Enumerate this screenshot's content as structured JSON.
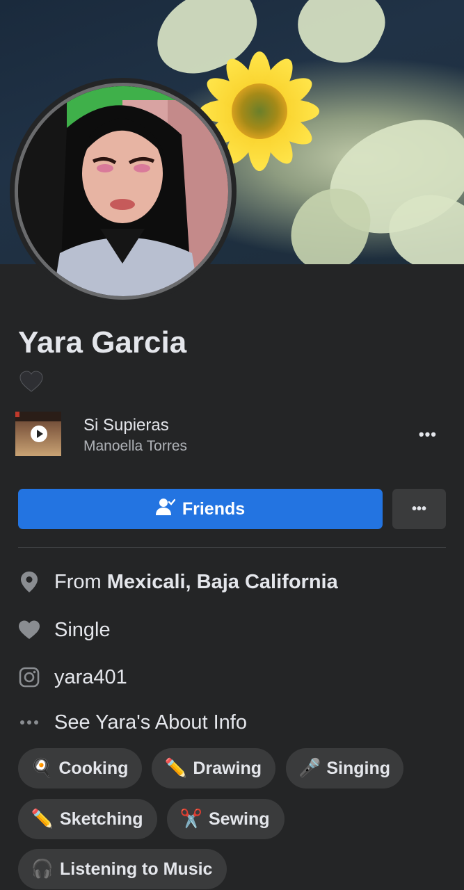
{
  "profile": {
    "name": "Yara Garcia",
    "bio_emoji": "🖤"
  },
  "profile_song": {
    "title": "Si Supieras",
    "artist": "Manoella Torres",
    "more_label": "•••"
  },
  "actions": {
    "friends_label": "Friends",
    "more_label": "•••"
  },
  "intro": {
    "from_prefix": "From ",
    "from_place": "Mexicali, Baja California",
    "relationship": "Single",
    "instagram": "yara401",
    "about_link": "See Yara's About Info"
  },
  "hobbies": [
    {
      "emoji": "🍳",
      "label": "Cooking"
    },
    {
      "emoji": "✏️",
      "label": "Drawing"
    },
    {
      "emoji": "🎤",
      "label": "Singing"
    },
    {
      "emoji": "✏️",
      "label": "Sketching"
    },
    {
      "emoji": "✂️",
      "label": "Sewing"
    },
    {
      "emoji": "🎧",
      "label": "Listening to Music"
    }
  ],
  "colors": {
    "background": "#242526",
    "primary_button": "#2374e1",
    "secondary_button": "#3a3b3c",
    "text_primary": "#e4e6eb",
    "text_secondary": "#b0b3b8"
  },
  "icons": {
    "location": "map-pin-icon",
    "relationship": "heart-icon",
    "instagram": "instagram-icon",
    "about": "ellipsis-icon",
    "friends": "person-check-icon"
  }
}
